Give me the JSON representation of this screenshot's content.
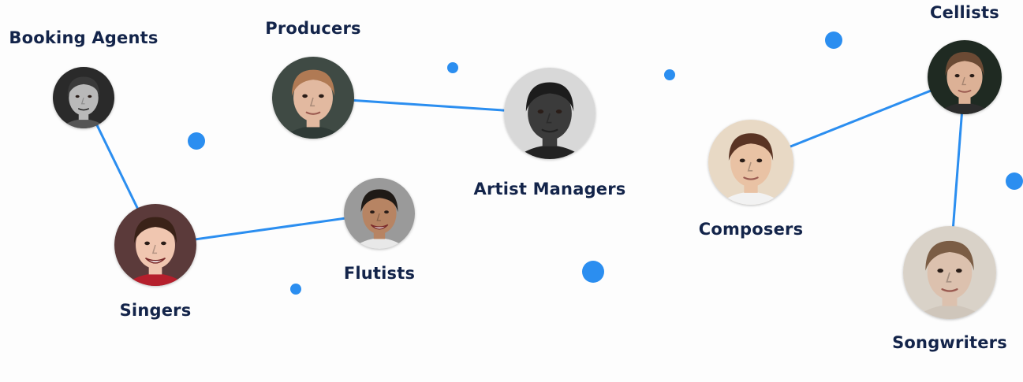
{
  "colors": {
    "accent": "#2b8ef0",
    "label_text": "#13244a",
    "background": "#fdfdfd"
  },
  "nodes": [
    {
      "id": "booking-agents",
      "label": "Booking Agents",
      "avatar_icon": "person-photo-monochrome-smiling-woman"
    },
    {
      "id": "producers",
      "label": "Producers",
      "avatar_icon": "person-photo-woman-long-hair"
    },
    {
      "id": "artist-managers",
      "label": "Artist Managers",
      "avatar_icon": "person-photo-monochrome-man"
    },
    {
      "id": "singers",
      "label": "Singers",
      "avatar_icon": "person-photo-laughing-woman"
    },
    {
      "id": "flutists",
      "label": "Flutists",
      "avatar_icon": "person-photo-smiling-man"
    },
    {
      "id": "composers",
      "label": "Composers",
      "avatar_icon": "person-photo-woman-braid"
    },
    {
      "id": "cellists",
      "label": "Cellists",
      "avatar_icon": "person-photo-woman-long-hair"
    },
    {
      "id": "songwriters",
      "label": "Songwriters",
      "avatar_icon": "person-photo-woman-freckles"
    }
  ],
  "connections": [
    {
      "from": "booking-agents",
      "to": "singers"
    },
    {
      "from": "singers",
      "to": "flutists"
    },
    {
      "from": "producers",
      "to": "artist-managers"
    },
    {
      "from": "composers",
      "to": "cellists"
    },
    {
      "from": "cellists",
      "to": "songwriters"
    }
  ]
}
